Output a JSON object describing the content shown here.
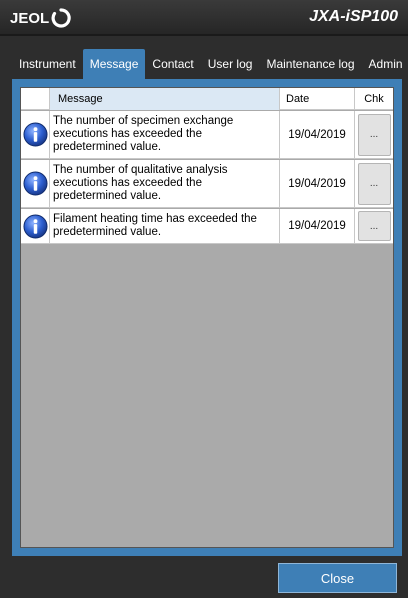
{
  "header": {
    "logo_text": "JEOL",
    "product_name": "JXA-iSP100"
  },
  "tabs": [
    {
      "label": "Instrument",
      "active": false
    },
    {
      "label": "Message",
      "active": true
    },
    {
      "label": "Contact",
      "active": false
    },
    {
      "label": "User log",
      "active": false
    },
    {
      "label": "Maintenance log",
      "active": false
    },
    {
      "label": "Admin",
      "active": false
    }
  ],
  "table": {
    "columns": {
      "message": "Message",
      "date": "Date",
      "chk": "Chk"
    },
    "rows": [
      {
        "icon": "info-icon",
        "message": "The number of specimen exchange executions has exceeded the predetermined value.",
        "date": "19/04/2019",
        "chk_label": "..."
      },
      {
        "icon": "info-icon",
        "message": "The number of qualitative analysis executions has exceeded the predetermined value.",
        "date": "19/04/2019",
        "chk_label": "..."
      },
      {
        "icon": "info-icon",
        "message": "Filament heating time has exceeded the predetermined value.",
        "date": "19/04/2019",
        "chk_label": "..."
      }
    ]
  },
  "footer": {
    "close_label": "Close"
  },
  "colors": {
    "accent": "#3e7fb6",
    "background": "#2d2d2d",
    "grid_empty": "#aaaaaa",
    "header_highlight": "#dbe8f4"
  }
}
